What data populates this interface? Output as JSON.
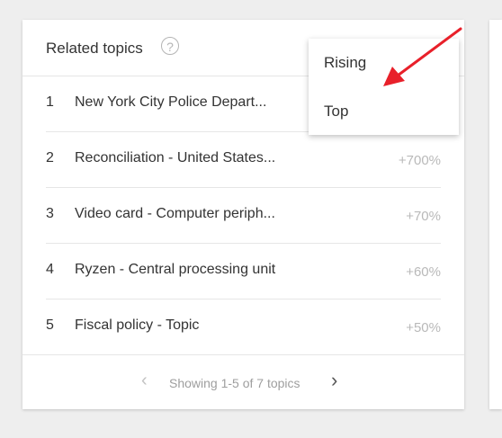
{
  "card": {
    "title": "Related topics",
    "help_icon": "?"
  },
  "rows": [
    {
      "rank": "1",
      "label": "New York City Police Depart...",
      "value": ""
    },
    {
      "rank": "2",
      "label": "Reconciliation - United States...",
      "value": "+700%"
    },
    {
      "rank": "3",
      "label": "Video card - Computer periph...",
      "value": "+70%"
    },
    {
      "rank": "4",
      "label": "Ryzen - Central processing unit",
      "value": "+60%"
    },
    {
      "rank": "5",
      "label": "Fiscal policy - Topic",
      "value": "+50%"
    }
  ],
  "pager": {
    "prev": "‹",
    "text": "Showing 1-5 of 7 topics",
    "next": "›"
  },
  "dropdown": {
    "items": [
      "Rising",
      "Top"
    ]
  },
  "colors": {
    "arrow": "#e8202a",
    "text": "#333333",
    "muted": "#b9b9b9"
  }
}
